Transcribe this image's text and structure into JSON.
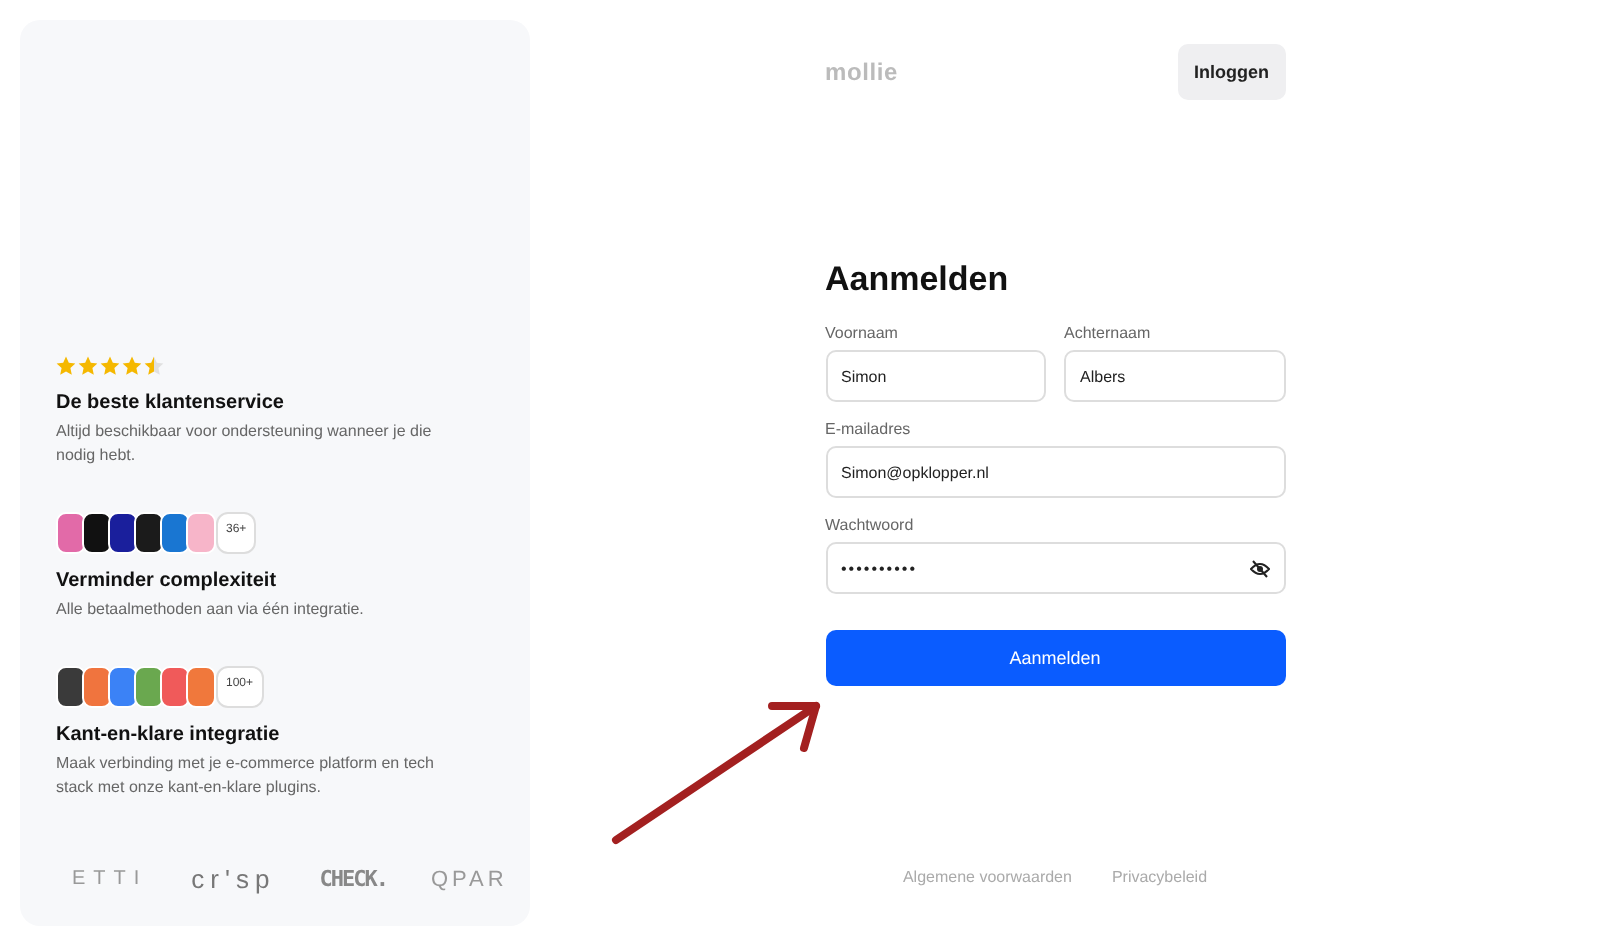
{
  "sidebar": {
    "features": [
      {
        "kind": "rating",
        "stars": 4.5,
        "title": "De beste klantenservice",
        "text": "Altijd beschikbaar voor ondersteuning wanneer je die nodig hebt."
      },
      {
        "kind": "icons",
        "icons": [
          {
            "color": "#e26aa8"
          },
          {
            "color": "#111111"
          },
          {
            "color": "#1a1f9c"
          },
          {
            "color": "#1b1b1b"
          },
          {
            "color": "#1976d2"
          },
          {
            "color": "#f7b5c9"
          }
        ],
        "count": "36+",
        "title": "Verminder complexiteit",
        "text": "Alle betaalmethoden aan via één integratie."
      },
      {
        "kind": "icons",
        "icons": [
          {
            "color": "#3a3a3a"
          },
          {
            "color": "#f0743e"
          },
          {
            "color": "#3b82f6"
          },
          {
            "color": "#6aa84f"
          },
          {
            "color": "#f05a5a"
          },
          {
            "color": "#f0783c"
          }
        ],
        "count": "100+",
        "title": "Kant-en-klare integratie",
        "text": "Maak verbinding met je e-commerce platform en tech stack met onze kant-en-klare plugins."
      }
    ],
    "logos": [
      "ETTI",
      "cr'sp",
      "CHECK.",
      "QPAR"
    ]
  },
  "header": {
    "logo": "mollie",
    "login_button": "Inloggen"
  },
  "form": {
    "title": "Aanmelden",
    "first_name": {
      "label": "Voornaam",
      "value": "Simon"
    },
    "last_name": {
      "label": "Achternaam",
      "value": "Albers"
    },
    "email": {
      "label": "E-mailadres",
      "value": "Simon@opklopper.nl"
    },
    "password": {
      "label": "Wachtwoord",
      "value": "••••••••••"
    },
    "submit": "Aanmelden"
  },
  "footer": {
    "links": [
      "Algemene voorwaarden",
      "Privacybeleid"
    ]
  }
}
